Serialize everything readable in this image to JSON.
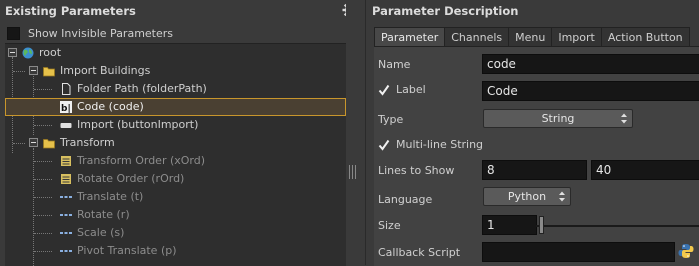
{
  "left_panel": {
    "title": "Existing Parameters",
    "show_invisible_label": "Show Invisible Parameters",
    "gear_icon": "gear-icon",
    "tree": [
      {
        "label": "root",
        "icon": "globe-icon",
        "level": 0,
        "expanded": true
      },
      {
        "label": "Import Buildings",
        "icon": "folder-icon",
        "level": 1,
        "expanded": true
      },
      {
        "label": "Folder Path (folderPath)",
        "icon": "file-icon",
        "level": 2
      },
      {
        "label": "Code (code)",
        "icon": "code-icon",
        "level": 2,
        "selected": true
      },
      {
        "label": "Import (buttonImport)",
        "icon": "button-icon",
        "level": 2
      },
      {
        "label": "Transform",
        "icon": "folder-icon",
        "level": 1,
        "expanded": true
      },
      {
        "label": "Transform Order (xOrd)",
        "icon": "menu-icon",
        "level": 2,
        "dim": true
      },
      {
        "label": "Rotate Order (rOrd)",
        "icon": "menu-icon",
        "level": 2,
        "dim": true
      },
      {
        "label": "Translate (t)",
        "icon": "vector-icon",
        "level": 2,
        "dim": true
      },
      {
        "label": "Rotate (r)",
        "icon": "vector-icon",
        "level": 2,
        "dim": true
      },
      {
        "label": "Scale (s)",
        "icon": "vector-icon",
        "level": 2,
        "dim": true
      },
      {
        "label": "Pivot Translate (p)",
        "icon": "vector-icon",
        "level": 2,
        "dim": true
      }
    ]
  },
  "right_panel": {
    "title": "Parameter Description",
    "tabs": [
      {
        "label": "Parameter",
        "active": true
      },
      {
        "label": "Channels"
      },
      {
        "label": "Menu"
      },
      {
        "label": "Import"
      },
      {
        "label": "Action Button"
      }
    ],
    "name_label": "Name",
    "name_value": "code",
    "label_label": "Label",
    "label_value": "Code",
    "type_label": "Type",
    "type_value": "String",
    "multiline_label": "Multi-line String",
    "lines_label": "Lines to Show",
    "lines_min": "8",
    "lines_max": "40",
    "language_label": "Language",
    "language_value": "Python",
    "size_label": "Size",
    "size_value": "1",
    "callback_label": "Callback Script",
    "callback_value": ""
  },
  "colors": {
    "selection_border": "#c8962c",
    "folder": "#e6c14a",
    "globe": "#4aa04a"
  }
}
